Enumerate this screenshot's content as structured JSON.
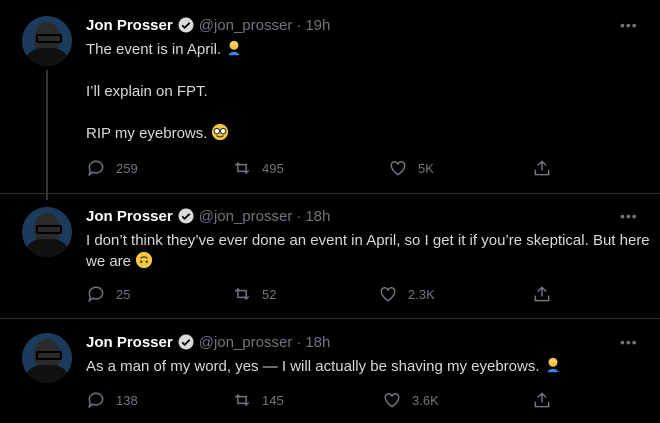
{
  "tweets": [
    {
      "name": "Jon Prosser",
      "handle": "@jon_prosser",
      "time": "19h",
      "paragraphs": [
        "The event is in April.",
        "I’ll explain on FPT.",
        "RIP my eyebrows."
      ],
      "reply_count": "259",
      "retweet_count": "495",
      "like_count": "5K"
    },
    {
      "name": "Jon Prosser",
      "handle": "@jon_prosser",
      "time": "18h",
      "paragraphs": [
        "I don’t think they’ve ever done an event in April, so I get it if you’re skeptical. But here we are"
      ],
      "reply_count": "25",
      "retweet_count": "52",
      "like_count": "2.3K"
    },
    {
      "name": "Jon Prosser",
      "handle": "@jon_prosser",
      "time": "18h",
      "paragraphs": [
        "As a man of my word, yes — I will actually be shaving my eyebrows."
      ],
      "reply_count": "138",
      "retweet_count": "145",
      "like_count": "3.6K"
    }
  ],
  "separator": "·",
  "more_label": "•••",
  "icons": {
    "verified": "verified-badge-icon",
    "reply": "reply-icon",
    "retweet": "retweet-icon",
    "like": "heart-icon",
    "share": "share-icon",
    "emoji_person": "person-facepalm-emoji",
    "emoji_nerd": "nerd-face-emoji",
    "emoji_upside": "upside-down-face-emoji"
  },
  "colors": {
    "background": "#000000",
    "text": "#d9d9d9",
    "muted": "#6e767d",
    "verified": "#1d9bf0"
  }
}
